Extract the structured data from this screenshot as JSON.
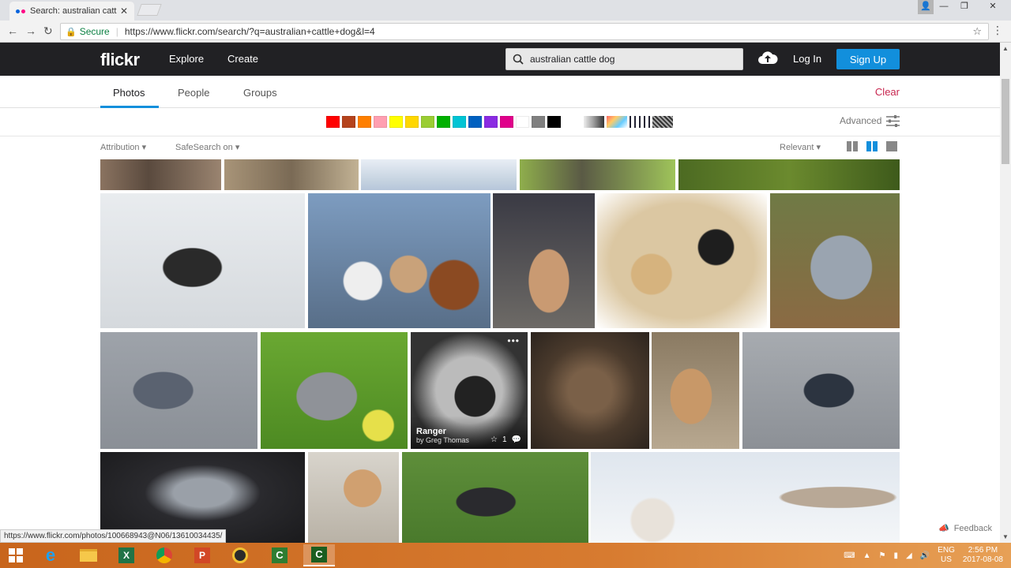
{
  "browser": {
    "tab_title": "Search: australian cattle dog",
    "tab_close": "✕",
    "secure_label": "Secure",
    "url": "https://www.flickr.com/search/?q=australian+cattle+dog&l=4",
    "status_url": "https://www.flickr.com/photos/100668943@N06/13610034435/"
  },
  "header": {
    "logo": "flickr",
    "nav": [
      "Explore",
      "Create"
    ],
    "search_value": "australian cattle dog",
    "login": "Log In",
    "signup": "Sign Up"
  },
  "search_tabs": {
    "items": [
      "Photos",
      "People",
      "Groups"
    ],
    "active": "Photos",
    "clear": "Clear"
  },
  "filters": {
    "colors": [
      "#ff0000",
      "#b5431d",
      "#ff7f00",
      "#ff9fb1",
      "#ffff00",
      "#ffd700",
      "#9acd32",
      "#00b000",
      "#00c4d4",
      "#0060c0",
      "#8a2be2",
      "#e0008a",
      "#ffffff",
      "#808080",
      "#000000"
    ],
    "advanced": "Advanced",
    "license": "Attribution",
    "safesearch": "SafeSearch on",
    "sort": "Relevant"
  },
  "photos": {
    "hovered_title": "Ranger",
    "hovered_by": "by Greg Thomas",
    "hovered_faves": "1"
  },
  "feedback": "Feedback",
  "taskbar": {
    "lang": "ENG",
    "region": "US",
    "time": "2:56 PM",
    "date": "2017-08-08"
  }
}
